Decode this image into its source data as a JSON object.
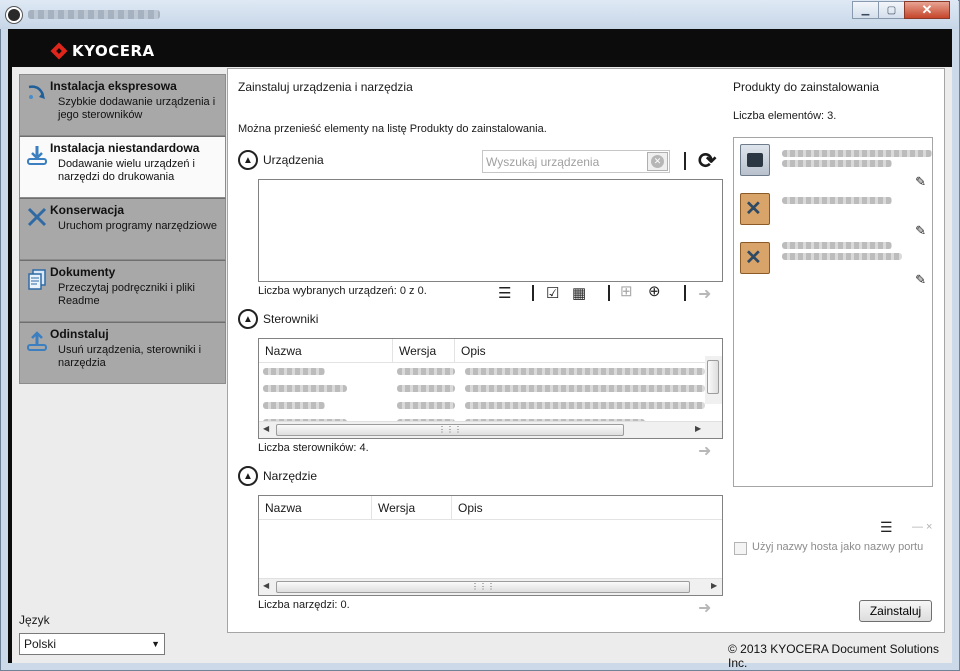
{
  "window": {
    "buttons": {
      "minimize": "▁",
      "maximize": "▢",
      "close": "✕"
    }
  },
  "brand": {
    "logo_text": "KYOCERA"
  },
  "nav": [
    {
      "title": "Instalacja ekspresowa",
      "desc": "Szybkie dodawanie urządzenia i jego sterowników",
      "icon": "express-install-icon",
      "active": false
    },
    {
      "title": "Instalacja niestandardowa",
      "desc": "Dodawanie wielu urządzeń i narzędzi do drukowania",
      "icon": "custom-install-icon",
      "active": true
    },
    {
      "title": "Konserwacja",
      "desc": "Uruchom programy narzędziowe",
      "icon": "maintenance-icon",
      "active": false
    },
    {
      "title": "Dokumenty",
      "desc": "Przeczytaj podręczniki i pliki Readme",
      "icon": "documents-icon",
      "active": false
    },
    {
      "title": "Odinstaluj",
      "desc": "Usuń urządzenia, sterowniki i narzędzia",
      "icon": "uninstall-icon",
      "active": false
    }
  ],
  "language": {
    "label": "Język",
    "value": "Polski"
  },
  "main": {
    "title": "Zainstaluj urządzenia i narzędzia",
    "hint": "Można przenieść elementy na listę Produkty do zainstalowania.",
    "devices": {
      "label": "Urządzenia",
      "search_placeholder": "Wyszukaj urządzenia",
      "count": "Liczba wybranych urządzeń: 0 z 0."
    },
    "drivers": {
      "label": "Sterowniki",
      "columns": [
        "Nazwa",
        "Wersja",
        "Opis"
      ],
      "count": "Liczba sterowników: 4."
    },
    "tools": {
      "label": "Narzędzie",
      "columns": [
        "Nazwa",
        "Wersja",
        "Opis"
      ],
      "count": "Liczba narzędzi: 0."
    }
  },
  "products": {
    "title": "Produkty do zainstalowania",
    "count": "Liczba elementów: 3.",
    "items": [
      {
        "icon": "printer-icon"
      },
      {
        "icon": "tools-icon"
      },
      {
        "icon": "tools-icon"
      }
    ],
    "hostname_checkbox": "Użyj nazwy hosta jako nazwy portu",
    "install_button": "Zainstaluj"
  },
  "footer": {
    "copyright": "© 2013 KYOCERA Document Solutions Inc."
  }
}
